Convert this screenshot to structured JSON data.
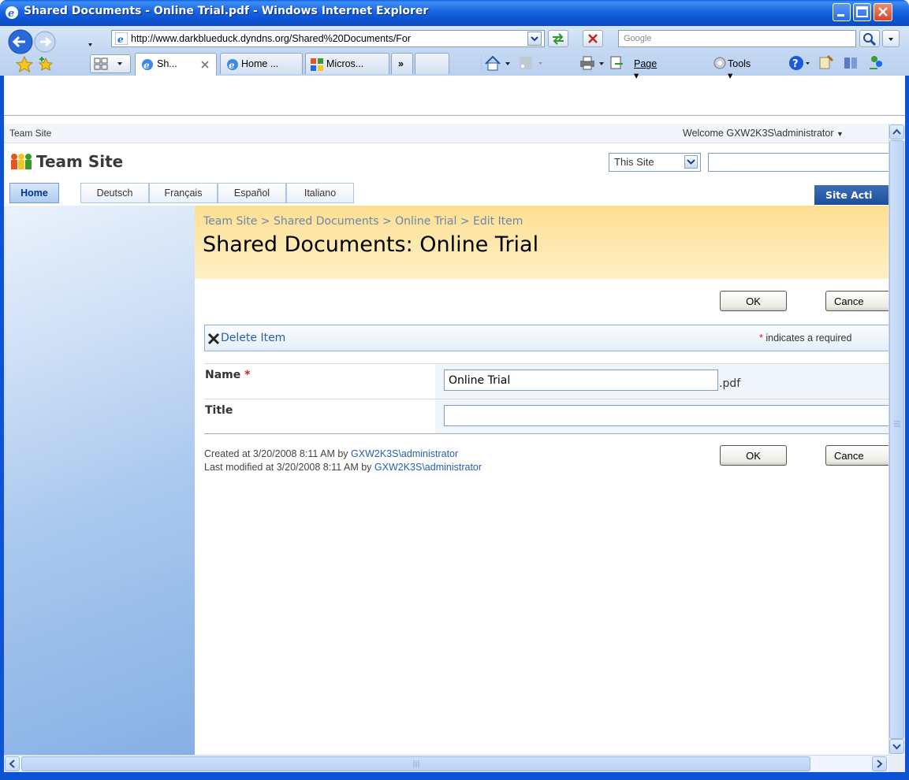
{
  "window": {
    "title": "Shared Documents - Online Trial.pdf - Windows Internet Explorer"
  },
  "address_bar": {
    "url": "http://www.darkblueduck.dyndns.org/Shared%20Documents/For",
    "search_placeholder": "Google"
  },
  "browser_tabs": [
    {
      "label": "Sh...",
      "active": true
    },
    {
      "label": "Home ...",
      "active": false
    },
    {
      "label": "Micros...",
      "active": false
    }
  ],
  "tabs_overflow": "»",
  "command_bar": {
    "page_label": "Page",
    "tools_label": "Tools"
  },
  "sharepoint": {
    "top_crumb": "Team Site",
    "welcome": "Welcome GXW2K3S\\administrator",
    "site_title": "Team Site",
    "search_scope": "This Site",
    "nav_tabs": [
      {
        "label": "Home",
        "active": true
      },
      {
        "label": "Deutsch",
        "active": false
      },
      {
        "label": "Français",
        "active": false
      },
      {
        "label": "Español",
        "active": false
      },
      {
        "label": "Italiano",
        "active": false
      }
    ],
    "site_actions": "Site Acti",
    "breadcrumb": "Team Site > Shared Documents > Online Trial > Edit Item",
    "page_title": "Shared Documents: Online Trial"
  },
  "form": {
    "ok_label": "OK",
    "cancel_label": "Cance",
    "delete_item": "Delete Item",
    "required_star": "*",
    "required_note": " indicates a required",
    "fields": {
      "name_label": "Name",
      "name_value": "Online Trial",
      "name_suffix": ".pdf",
      "title_label": "Title",
      "title_value": ""
    },
    "created_prefix": "Created at 3/20/2008 8:11 AM  by ",
    "created_by": "GXW2K3S\\administrator",
    "modified_prefix": "Last modified at 3/20/2008 8:11 AM  by ",
    "modified_by": "GXW2K3S\\administrator"
  },
  "colors": {
    "titlebar": "#0c54d4",
    "link": "#2860b0",
    "title_area": "#fddf92",
    "required": "#d0201a"
  }
}
